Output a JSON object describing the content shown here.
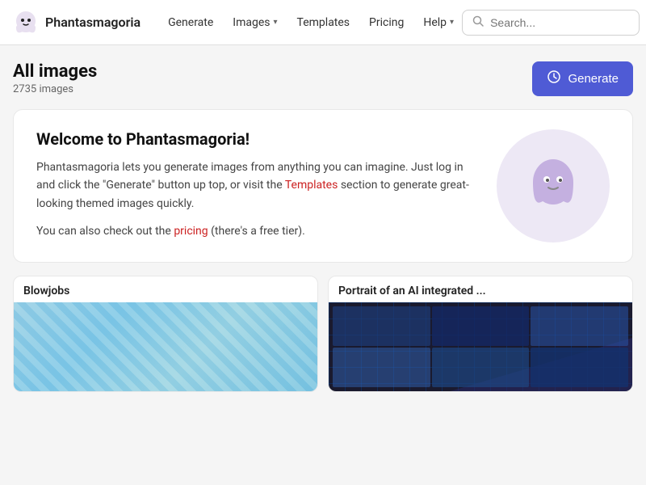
{
  "header": {
    "logo_text": "Phantasmagoria",
    "nav_items": [
      {
        "label": "Generate",
        "has_dropdown": false
      },
      {
        "label": "Images",
        "has_dropdown": true
      },
      {
        "label": "Templates",
        "has_dropdown": false
      },
      {
        "label": "Pricing",
        "has_dropdown": false
      },
      {
        "label": "Help",
        "has_dropdown": true
      }
    ],
    "search_placeholder": "Search...",
    "generate_button_label": "Generate"
  },
  "main": {
    "page_title": "All images",
    "image_count": "2735 images",
    "generate_button_label": "Generate",
    "welcome_card": {
      "title": "Welcome to Phantasmagoria!",
      "body1": "Phantasmagoria lets you generate images from anything you can imagine. Just log in and click the \"Generate\" button up top, or visit the",
      "templates_link": "Templates",
      "body1_end": "section to generate great-looking themed images quickly.",
      "body2_start": "You can also check out the",
      "pricing_link": "pricing",
      "body2_end": "(there's a free tier)."
    },
    "image_cards": [
      {
        "title": "Blowjobs",
        "type": "hose"
      },
      {
        "title": "Portrait of an AI integrated ...",
        "type": "tech"
      }
    ]
  }
}
